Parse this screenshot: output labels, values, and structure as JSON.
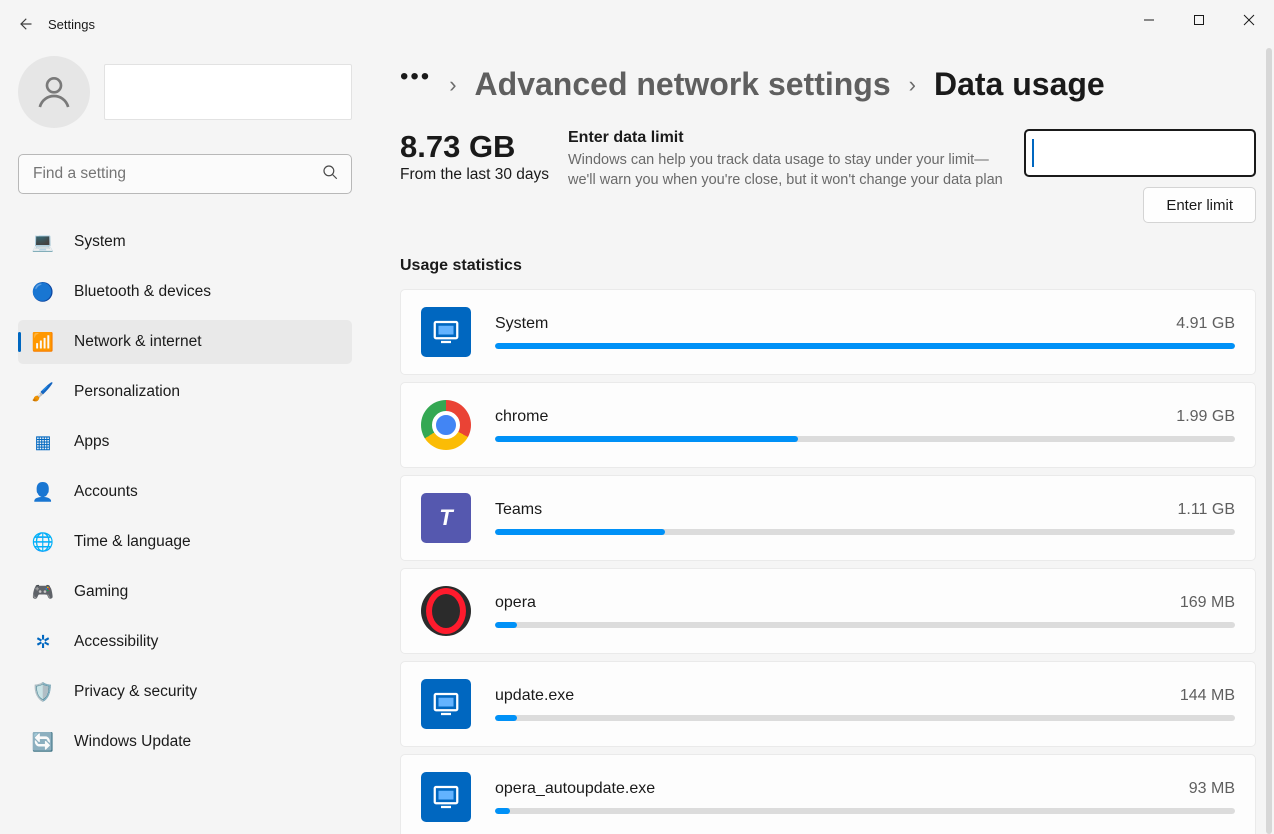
{
  "window": {
    "title": "Settings"
  },
  "search": {
    "placeholder": "Find a setting"
  },
  "nav": {
    "items": [
      {
        "label": "System"
      },
      {
        "label": "Bluetooth & devices"
      },
      {
        "label": "Network & internet"
      },
      {
        "label": "Personalization"
      },
      {
        "label": "Apps"
      },
      {
        "label": "Accounts"
      },
      {
        "label": "Time & language"
      },
      {
        "label": "Gaming"
      },
      {
        "label": "Accessibility"
      },
      {
        "label": "Privacy & security"
      },
      {
        "label": "Windows Update"
      }
    ],
    "selected_index": 2
  },
  "breadcrumb": {
    "parent": "Advanced network settings",
    "current": "Data usage"
  },
  "summary": {
    "total": "8.73 GB",
    "period": "From the last 30 days"
  },
  "limit": {
    "title": "Enter data limit",
    "desc": "Windows can help you track data usage to stay under your limit—we'll warn you when you're close, but it won't change your data plan",
    "button": "Enter limit"
  },
  "stats": {
    "heading": "Usage statistics",
    "max_bytes": 5273000000,
    "apps": [
      {
        "name": "System",
        "size_label": "4.91 GB",
        "bytes": 5273000000,
        "icon": "system"
      },
      {
        "name": "chrome",
        "size_label": "1.99 GB",
        "bytes": 2137000000,
        "icon": "chrome"
      },
      {
        "name": "Teams",
        "size_label": "1.11 GB",
        "bytes": 1192000000,
        "icon": "teams"
      },
      {
        "name": "opera",
        "size_label": "169 MB",
        "bytes": 177000000,
        "icon": "opera"
      },
      {
        "name": "update.exe",
        "size_label": "144 MB",
        "bytes": 151000000,
        "icon": "update"
      },
      {
        "name": "opera_autoupdate.exe",
        "size_label": "93 MB",
        "bytes": 97500000,
        "icon": "update"
      }
    ]
  }
}
